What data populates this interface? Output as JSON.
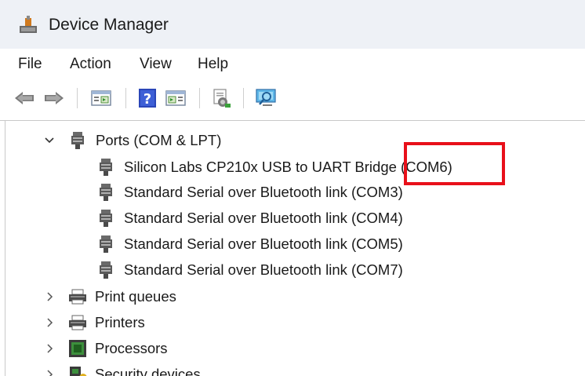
{
  "window": {
    "title": "Device Manager"
  },
  "menu": {
    "items": [
      "File",
      "Action",
      "View",
      "Help"
    ]
  },
  "toolbar": {
    "buttons": [
      "back-arrow",
      "forward-arrow",
      "show-hide-console-tree",
      "help",
      "properties-pane",
      "update-driver",
      "scan-hardware-changes"
    ]
  },
  "tree": {
    "ports_group": {
      "label": "Ports (COM & LPT)",
      "expanded": true,
      "children": [
        "Silicon Labs CP210x USB to UART Bridge (COM6)",
        "Standard Serial over Bluetooth link (COM3)",
        "Standard Serial over Bluetooth link (COM4)",
        "Standard Serial over Bluetooth link (COM5)",
        "Standard Serial over Bluetooth link (COM7)"
      ]
    },
    "collapsed_groups": [
      {
        "label": "Print queues",
        "icon": "print-queue-icon"
      },
      {
        "label": "Printers",
        "icon": "printer-icon"
      },
      {
        "label": "Processors",
        "icon": "processor-icon"
      },
      {
        "label": "Security devices",
        "icon": "security-device-icon"
      }
    ]
  },
  "annotation": {
    "color": "#e8101a"
  }
}
